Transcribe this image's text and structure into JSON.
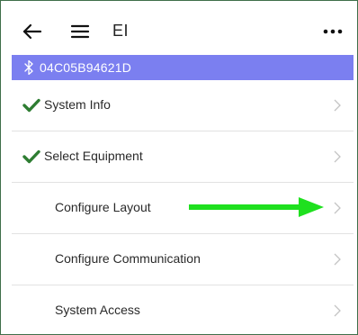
{
  "header": {
    "title": "EI",
    "back_icon": "arrow-left-icon",
    "menu_icon": "hamburger-icon",
    "more_icon": "ellipsis-icon"
  },
  "device": {
    "id": "04C05B94621D",
    "icon": "bluetooth-icon"
  },
  "menu_items": [
    {
      "label": "System Info",
      "checked": true
    },
    {
      "label": "Select Equipment",
      "checked": true
    },
    {
      "label": "Configure Layout",
      "checked": false
    },
    {
      "label": "Configure Communication",
      "checked": false
    },
    {
      "label": "System Access",
      "checked": false
    }
  ],
  "colors": {
    "accent": "#7b7ff0",
    "check": "#2e7d32",
    "highlight_arrow": "#1fe01f",
    "border": "#3f6f4a"
  }
}
